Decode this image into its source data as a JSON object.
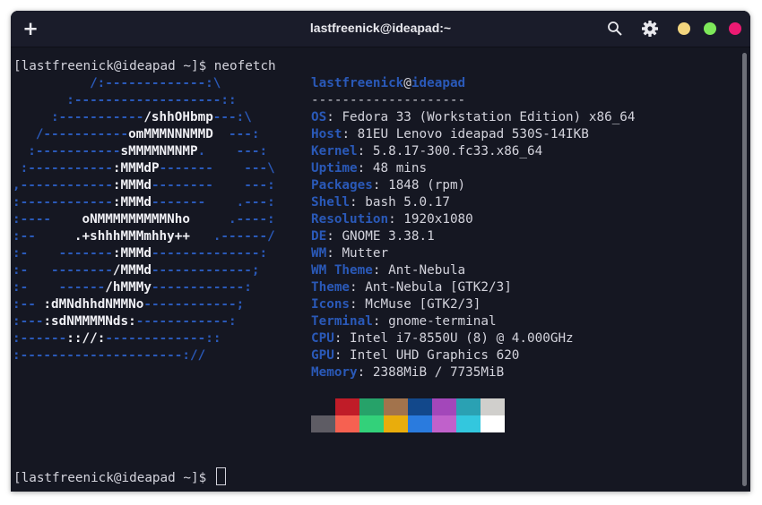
{
  "window": {
    "title": "lastfreenick@ideapad:~",
    "new_tab_label": "+"
  },
  "icons": {
    "new_tab": "plus-icon",
    "search": "search-icon",
    "menu": "gear-icon"
  },
  "colors": {
    "background": "#151722",
    "titlebar": "#1a1c2a",
    "accent_blue": "#2a59b8",
    "minimize": "#f2d57e",
    "maximize": "#7ee85a",
    "close": "#ec1a72"
  },
  "terminal": {
    "prompt1": "[lastfreenick@ideapad ~]$ neofetch",
    "prompt2": "[lastfreenick@ideapad ~]$ ",
    "logo": [
      {
        "pre": "          /:-------------:\\",
        "w": "",
        "post": ""
      },
      {
        "pre": "       :-------------------::",
        "w": "",
        "post": ""
      },
      {
        "pre": "     :-----------",
        "w": "/shhOHbmp",
        "post": "---:\\"
      },
      {
        "pre": "   /-----------",
        "w": "omMMMNNNMMD",
        "post": "  ---:"
      },
      {
        "pre": "  :-----------",
        "w": "sMMMMNMNMP",
        "post": ".    ---:"
      },
      {
        "pre": " :-----------",
        "w": ":MMMdP",
        "post": "-------    ---\\"
      },
      {
        "pre": ",------------",
        "w": ":MMMd",
        "post": "--------    ---:"
      },
      {
        "pre": ":------------",
        "w": ":MMMd",
        "post": "-------    .---:"
      },
      {
        "pre": ":----    ",
        "w": "oNMMMMMMMMMNho",
        "post": "     .----:"
      },
      {
        "pre": ":--     ",
        "w": ".+shhhMMMmhhy++",
        "post": "   .------/"
      },
      {
        "pre": ":-    -------",
        "w": ":MMMd",
        "post": "--------------:"
      },
      {
        "pre": ":-   --------",
        "w": "/MMMd",
        "post": "-------------;"
      },
      {
        "pre": ":-    ------",
        "w": "/hMMMy",
        "post": "------------:"
      },
      {
        "pre": ":-- ",
        "w": ":dMNdhhdNMMNo",
        "post": "------------;"
      },
      {
        "pre": ":---",
        "w": ":sdNMMMMNds:",
        "post": "------------:"
      },
      {
        "pre": ":------",
        "w": ":://:",
        "post": "-------------::"
      },
      {
        "pre": ":---------------------://",
        "w": "",
        "post": ""
      }
    ],
    "info_header": {
      "user": "lastfreenick",
      "at": "@",
      "host": "ideapad"
    },
    "info_separator": "--------------------",
    "info": [
      {
        "key": "OS",
        "value": "Fedora 33 (Workstation Edition) x86_64"
      },
      {
        "key": "Host",
        "value": "81EU Lenovo ideapad 530S-14IKB"
      },
      {
        "key": "Kernel",
        "value": "5.8.17-300.fc33.x86_64"
      },
      {
        "key": "Uptime",
        "value": "48 mins"
      },
      {
        "key": "Packages",
        "value": "1848 (rpm)"
      },
      {
        "key": "Shell",
        "value": "bash 5.0.17"
      },
      {
        "key": "Resolution",
        "value": "1920x1080"
      },
      {
        "key": "DE",
        "value": "GNOME 3.38.1"
      },
      {
        "key": "WM",
        "value": "Mutter"
      },
      {
        "key": "WM Theme",
        "value": "Ant-Nebula"
      },
      {
        "key": "Theme",
        "value": "Ant-Nebula [GTK2/3]"
      },
      {
        "key": "Icons",
        "value": "McMuse [GTK2/3]"
      },
      {
        "key": "Terminal",
        "value": "gnome-terminal"
      },
      {
        "key": "CPU",
        "value": "Intel i7-8550U (8) @ 4.000GHz"
      },
      {
        "key": "GPU",
        "value": "Intel UHD Graphics 620"
      },
      {
        "key": "Memory",
        "value": "2388MiB / 7735MiB"
      }
    ],
    "palette_top": [
      "#151722",
      "#c01c28",
      "#26a269",
      "#a2734c",
      "#12488b",
      "#a347ba",
      "#2aa1b3",
      "#d0cfcc"
    ],
    "palette_bottom": [
      "#5e5c64",
      "#f66151",
      "#33d17a",
      "#e9ad0c",
      "#2a7bde",
      "#c061cb",
      "#33c7de",
      "#ffffff"
    ]
  }
}
